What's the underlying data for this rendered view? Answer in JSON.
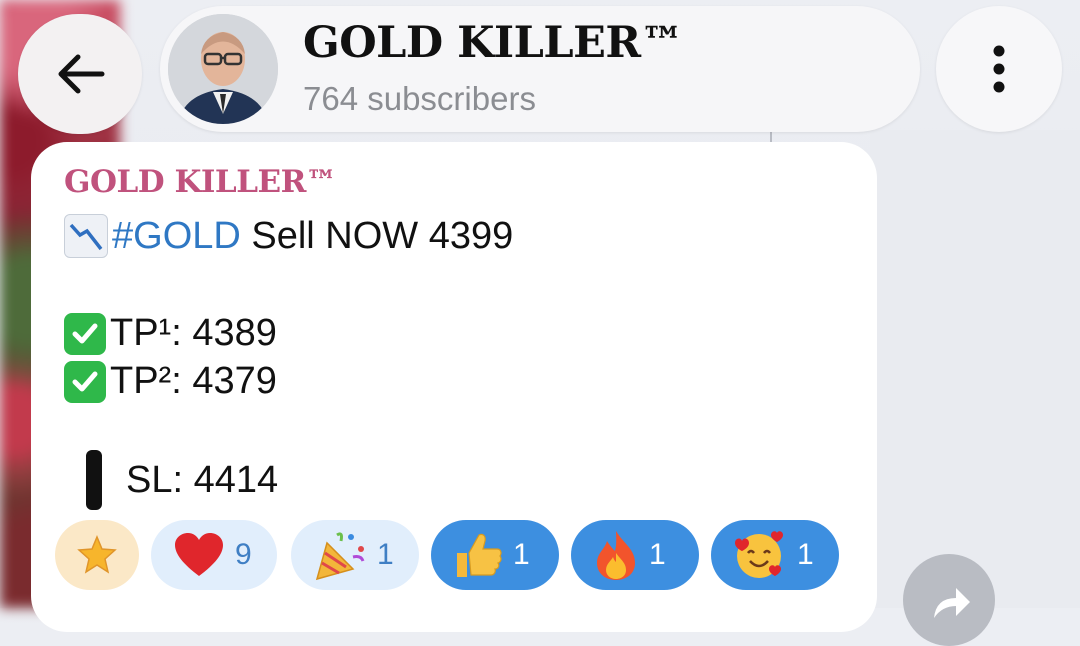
{
  "header": {
    "title": "GOLD KILLER™",
    "subtitle": "764 subscribers"
  },
  "message": {
    "sender": "GOLD KILLER™",
    "line1_hashtag": "#GOLD",
    "line1_text": " Sell NOW 4399",
    "tp1": "TP¹: 4389",
    "tp2": "TP²: 4379",
    "sl": "SL: 4414"
  },
  "reactions": [
    {
      "icon": "star-icon",
      "count": ""
    },
    {
      "icon": "heart-icon",
      "count": "9"
    },
    {
      "icon": "party-popper-icon",
      "count": "1"
    },
    {
      "icon": "thumbs-up-icon",
      "count": "1"
    },
    {
      "icon": "fire-icon",
      "count": "1"
    },
    {
      "icon": "smiling-face-with-hearts-icon",
      "count": "1"
    }
  ],
  "colors": {
    "sender_name": "#c0527d",
    "hashtag": "#2f78c4",
    "reaction_active": "#3d8fe0",
    "reaction_inactive": "#e1eefc"
  }
}
